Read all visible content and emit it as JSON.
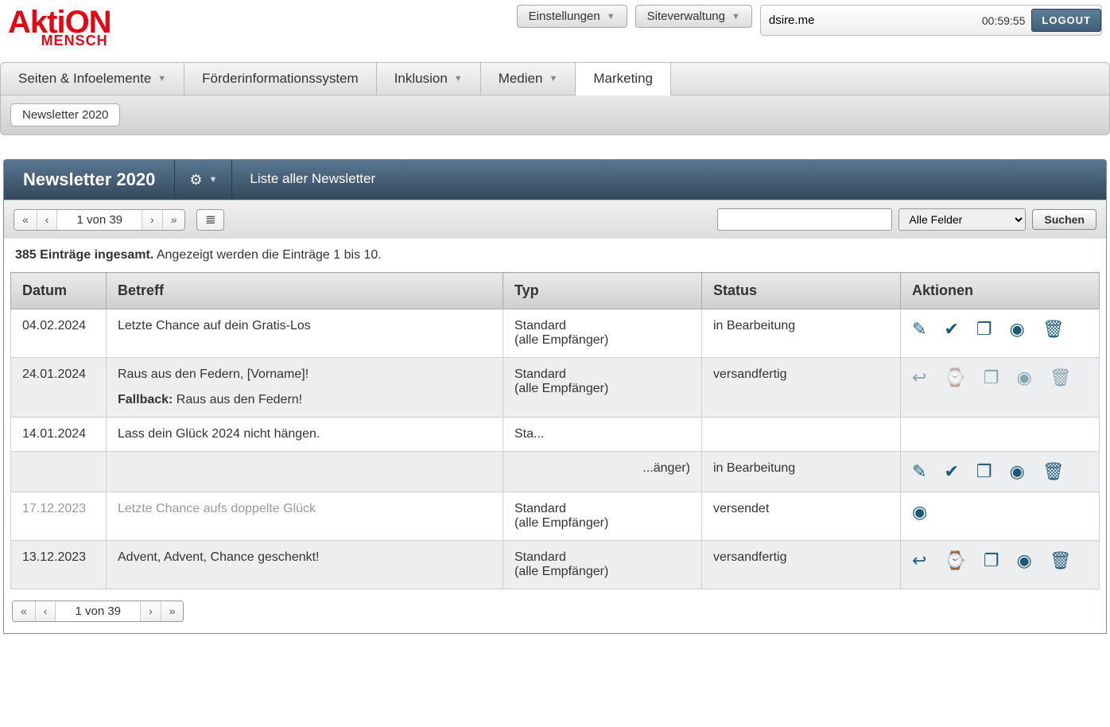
{
  "top": {
    "settings": "Einstellungen",
    "siteadmin": "Siteverwaltung",
    "user": "dsire.me",
    "timer": "00:59:55",
    "logout": "LOGOUT"
  },
  "logo": {
    "main": "AktiON",
    "sub": "MENSCH"
  },
  "nav": {
    "tabs": [
      {
        "label": "Seiten & Infoelemente",
        "dd": true
      },
      {
        "label": "Förderinformationssystem",
        "dd": false
      },
      {
        "label": "Inklusion",
        "dd": true
      },
      {
        "label": "Medien",
        "dd": true
      },
      {
        "label": "Marketing",
        "dd": false,
        "active": true
      }
    ],
    "subtab": "Newsletter 2020"
  },
  "panel": {
    "title": "Newsletter 2020",
    "crumb": "Liste aller Newsletter"
  },
  "pager": {
    "info": "1 von 39"
  },
  "search": {
    "field_select": "Alle Felder",
    "btn": "Suchen"
  },
  "summary": {
    "bold": "385 Einträge ingesamt.",
    "rest": " Angezeigt werden die Einträge 1 bis 10."
  },
  "columns": {
    "c1": "Datum",
    "c2": "Betreff",
    "c3": "Typ",
    "c4": "Status",
    "c5": "Aktionen"
  },
  "rows": [
    {
      "date": "04.02.2024",
      "subject": "Letzte Chance auf dein Gratis-Los",
      "type1": "Standard",
      "type2": "(alle Empfänger)",
      "status": "in Bearbeitung",
      "icons": [
        "pencil",
        "check",
        "copy",
        "eye",
        "trash"
      ]
    },
    {
      "date": "24.01.2024",
      "subject": "Raus aus den Federn, [Vorname]!",
      "fallback_label": "Fallback:",
      "fallback": " Raus aus den Federn!",
      "type1": "Standard",
      "type2": "(alle Empfänger)",
      "status": "versandfertig",
      "icons": [
        "reply",
        "clock",
        "copy",
        "eye",
        "trash"
      ],
      "iconsCut": true
    },
    {
      "date": "14.01.2024",
      "subject": "Lass dein Glück 2024 nicht hängen.",
      "type1": "Sta...",
      "type2": "",
      "status": "",
      "icons": []
    },
    {
      "date": "",
      "subject": "",
      "type1": "",
      "type2": "...änger)",
      "type2align": "right",
      "status": "in Bearbeitung",
      "icons": [
        "pencil",
        "check",
        "copy",
        "eye",
        "trash"
      ]
    },
    {
      "date": "17.12.2023",
      "subject": "Letzte Chance aufs doppelte Glück",
      "type1": "Standard",
      "type2": "(alle Empfänger)",
      "status": "versendet",
      "icons": [
        "eye"
      ],
      "dim": true
    },
    {
      "date": "13.12.2023",
      "subject": "Advent, Advent, Chance geschenkt!",
      "type1": "Standard",
      "type2": "(alle Empfänger)",
      "status": "versandfertig",
      "icons": [
        "reply",
        "clock",
        "copy",
        "eye",
        "trash"
      ]
    }
  ],
  "icon_glyphs": {
    "pencil": "✎",
    "check": "✔",
    "copy": "❐",
    "eye": "◉",
    "trash": "🗑",
    "reply": "↩",
    "clock": "⌚"
  }
}
